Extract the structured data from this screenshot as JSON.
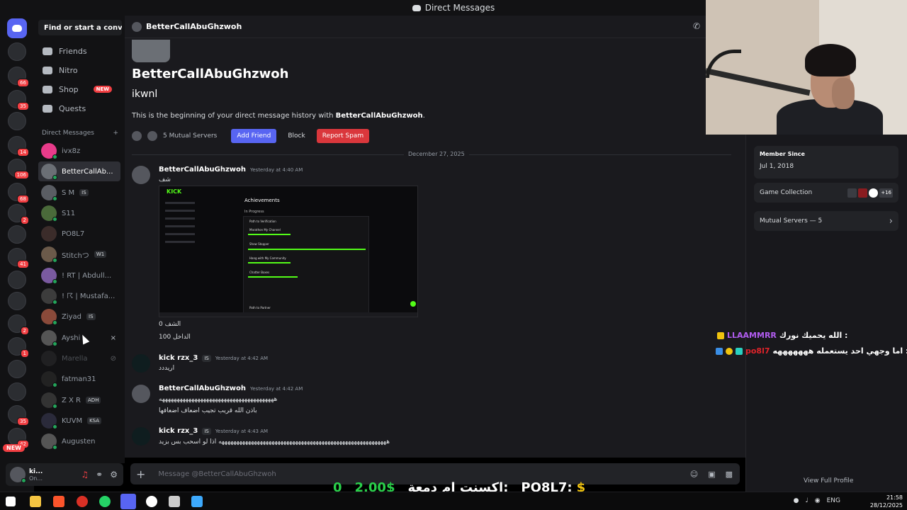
{
  "window": {
    "title": "Direct Messages"
  },
  "search": {
    "placeholder": "Find or start a convers..."
  },
  "nav": [
    {
      "label": "Friends",
      "icon": "friends-icon"
    },
    {
      "label": "Nitro",
      "icon": "nitro-icon"
    },
    {
      "label": "Shop",
      "icon": "shop-icon",
      "badge": "NEW"
    },
    {
      "label": "Quests",
      "icon": "quests-icon"
    }
  ],
  "dm_header": {
    "label": "Direct Messages",
    "add": "+"
  },
  "dms": [
    {
      "name": "ivx8z",
      "tag": ""
    },
    {
      "name": "BetterCallAb...",
      "tag": ""
    },
    {
      "name": "S M",
      "tag": "IS"
    },
    {
      "name": "S11",
      "tag": ""
    },
    {
      "name": "PO8L7",
      "tag": ""
    },
    {
      "name": "Stitchつ",
      "tag": "W1"
    },
    {
      "name": "! RT | Abdull...",
      "tag": ""
    },
    {
      "name": "! ☈ | Mustafa...",
      "tag": ""
    },
    {
      "name": "Ziyad",
      "tag": "IS"
    },
    {
      "name": "Ayshi",
      "tag": ""
    },
    {
      "name": "Marella",
      "tag": ""
    },
    {
      "name": "fatman31",
      "tag": ""
    },
    {
      "name": "Z X R",
      "tag": "ADH"
    },
    {
      "name": "KUVM",
      "tag": "KSA"
    },
    {
      "name": "Augusten",
      "tag": ""
    }
  ],
  "servers": [
    {
      "badge": ""
    },
    {
      "badge": "66"
    },
    {
      "badge": "35"
    },
    {
      "badge": ""
    },
    {
      "badge": "14"
    },
    {
      "badge": "106"
    },
    {
      "badge": "68"
    },
    {
      "badge": "2"
    },
    {
      "badge": ""
    },
    {
      "badge": "41"
    },
    {
      "badge": ""
    },
    {
      "badge": ""
    },
    {
      "badge": "2"
    },
    {
      "badge": "1"
    },
    {
      "badge": ""
    },
    {
      "badge": ""
    },
    {
      "badge": "35"
    },
    {
      "badge": "42"
    }
  ],
  "server_new": "NEW",
  "user": {
    "name": "ki...",
    "status": "On..."
  },
  "chat": {
    "recipient": "BetterCallAbuGhzwoh",
    "title": "BetterCallAbuGhzwoh",
    "subtitle": "ikwnl",
    "intro_prefix": "This is the beginning of your direct message history with ",
    "intro_name": "BetterCallAbuGhzwoh",
    "intro_suffix": ".",
    "mutual": "5 Mutual Servers",
    "add_friend": "Add Friend",
    "block": "Block",
    "report": "Report Spam",
    "date": "December 27, 2025",
    "input_placeholder": "Message @BetterCallAbuGhzwoh"
  },
  "messages": [
    {
      "author": "BetterCallAbuGhzwoh",
      "time": "Yesterday at 4:40 AM",
      "lines": [
        "شف"
      ]
    },
    {
      "author": "kick rzx_3",
      "tag": "IS",
      "time": "Yesterday at 4:42 AM",
      "lines": [
        "اريددد"
      ]
    },
    {
      "author": "BetterCallAbuGhzwoh",
      "time": "Yesterday at 4:42 AM",
      "lines": [
        "هههههههههههههههههههههههههههههههههههههههه",
        "باذن الله قريب تجيب اضعاف اضعافها"
      ]
    },
    {
      "author": "kick rzx_3",
      "tag": "IS",
      "time": "Yesterday at 4:43 AM",
      "lines": [
        "هههههههههههههههههههههههههههههههههههههههههههههههههههههههههه اذا لو اسحب بس بزيد"
      ]
    }
  ],
  "attachment": {
    "brand": "KICK",
    "heading": "Achievements",
    "sub": "In Progress",
    "items": [
      "Path to Verification",
      "Marathon My Channel",
      "Show Stopper",
      "Hang with My Community",
      "Chatter Boxes",
      "Path to Partner"
    ]
  },
  "after_image": [
    "الشف 0",
    "الداخل 100"
  ],
  "profile": {
    "member_since_label": "Member Since",
    "member_since": "Jul 1, 2018",
    "game_label": "Game Collection",
    "game_more": "+16",
    "mutual_servers": "Mutual Servers — 5",
    "view_full": "View Full Profile"
  },
  "overlay": {
    "line1_name": "LLAAMMRR",
    "line1_text": "الله يحميك نورك :",
    "line2_name": "po8l7",
    "line2_text": "اما وجهي احد يستعمله هههههههه :"
  },
  "donation": {
    "count": "0",
    "amount": "2.00$",
    "label": "اكسنت ام دمعة:",
    "name": "PO8L7:",
    "sym": "$"
  },
  "taskbar": {
    "lang": "ENG",
    "time": "21:58",
    "date": "28/12/2025"
  },
  "colors": {
    "accent": "#5865f2",
    "danger": "#da373c",
    "kick": "#53fc18",
    "online": "#23a55a"
  }
}
